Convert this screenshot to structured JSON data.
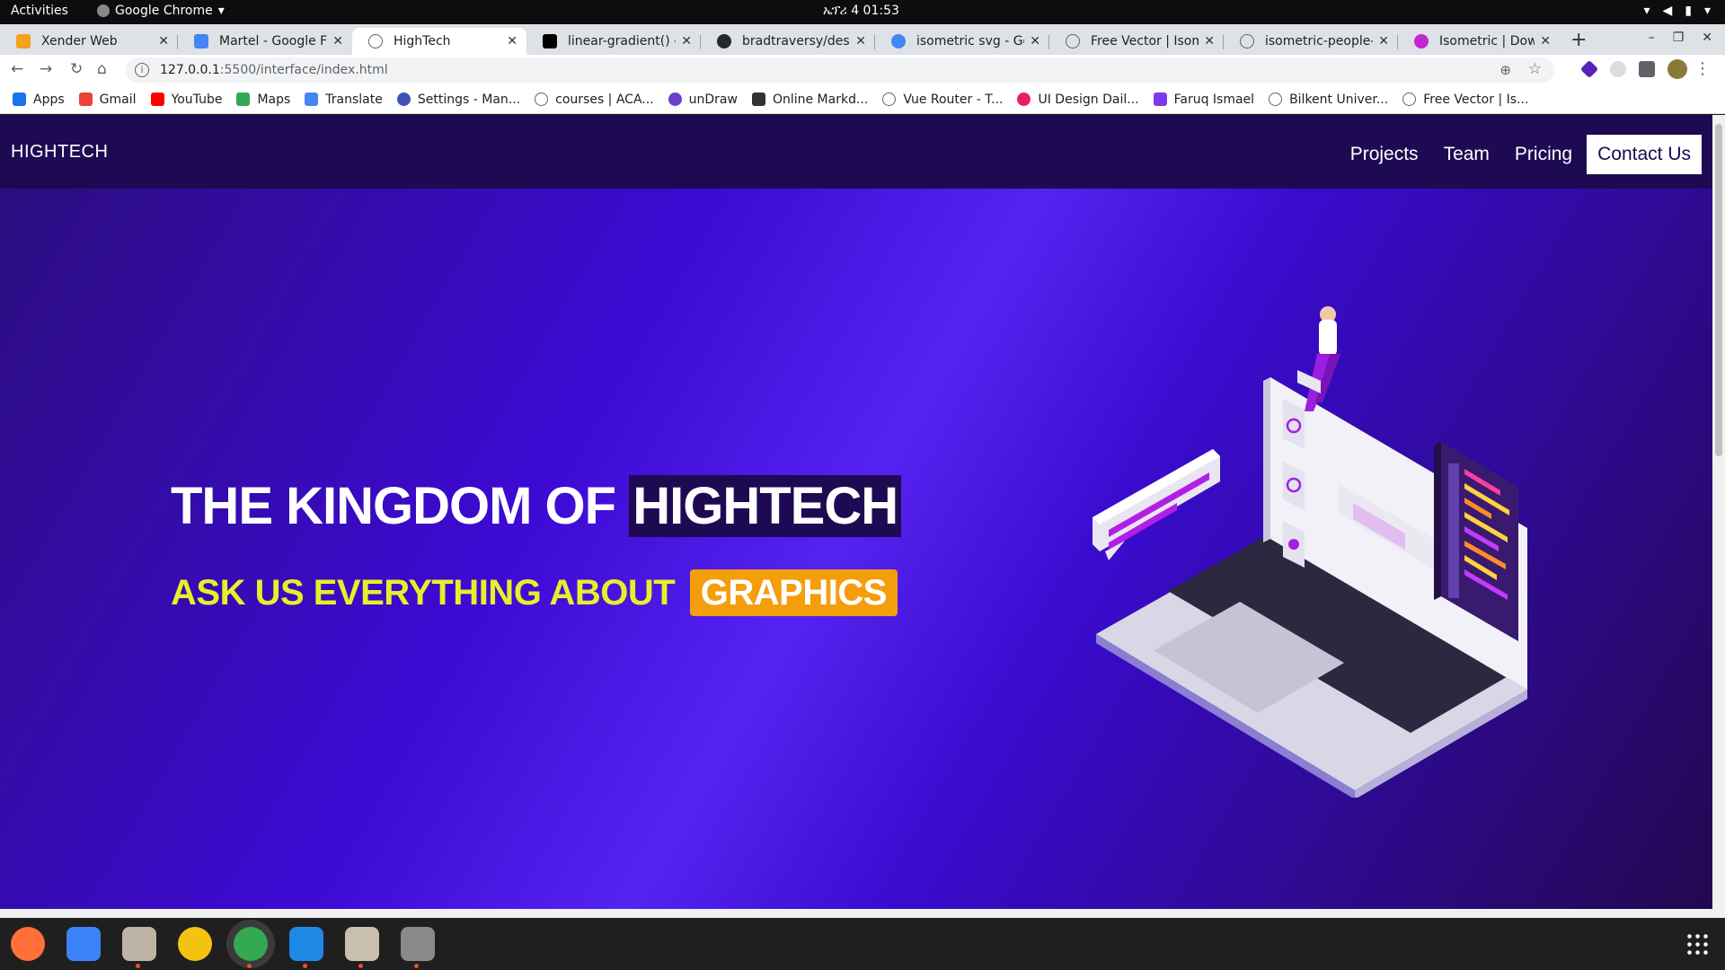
{
  "system": {
    "activities": "Activities",
    "app_name": "Google Chrome",
    "clock": "ኤፕሪ 4  01:53"
  },
  "tabs": [
    {
      "title": "Xender Web",
      "icon": "xender-icon",
      "color": "#f4a21d"
    },
    {
      "title": "Martel - Google Fo",
      "icon": "google-fonts-icon",
      "color": "#4285f4"
    },
    {
      "title": "HighTech",
      "icon": "globe-icon",
      "color": "#5f6368",
      "active": true
    },
    {
      "title": "linear-gradient() - ",
      "icon": "mdn-icon",
      "color": "#000000"
    },
    {
      "title": "bradtraversy/desig",
      "icon": "github-icon",
      "color": "#24292e"
    },
    {
      "title": "isometric svg - Goo",
      "icon": "google-icon",
      "color": "#4285f4"
    },
    {
      "title": "Free Vector | Isome",
      "icon": "globe-icon",
      "color": "#5f6368"
    },
    {
      "title": "isometric-people-v",
      "icon": "globe-icon",
      "color": "#5f6368"
    },
    {
      "title": "Isometric | Downlo",
      "icon": "undraw-icon",
      "color": "#c026d3"
    }
  ],
  "toolbar": {
    "url_host": "127.0.0.1",
    "url_rest": ":5500/interface/index.html"
  },
  "bookmarks": [
    {
      "label": "Apps",
      "icon": "apps-grid-icon",
      "color": "#1a73e8"
    },
    {
      "label": "Gmail",
      "icon": "gmail-icon",
      "color": "#ea4335"
    },
    {
      "label": "YouTube",
      "icon": "youtube-icon",
      "color": "#ff0000"
    },
    {
      "label": "Maps",
      "icon": "maps-icon",
      "color": "#34a853"
    },
    {
      "label": "Translate",
      "icon": "translate-icon",
      "color": "#4285f4"
    },
    {
      "label": "Settings - Man...",
      "icon": "settings-icon",
      "color": "#3f51b5"
    },
    {
      "label": "courses | ACA...",
      "icon": "globe-icon",
      "color": "#5f6368"
    },
    {
      "label": "unDraw",
      "icon": "undraw-icon",
      "color": "#6c3fc9"
    },
    {
      "label": "Online Markd...",
      "icon": "dillinger-icon",
      "color": "#333333"
    },
    {
      "label": "Vue Router - T...",
      "icon": "globe-icon",
      "color": "#5f6368"
    },
    {
      "label": "UI Design Dail...",
      "icon": "uidesign-icon",
      "color": "#e91e63"
    },
    {
      "label": "Faruq Ismael",
      "icon": "faruq-icon",
      "color": "#7c3aed"
    },
    {
      "label": "Bilkent Univer...",
      "icon": "globe-icon",
      "color": "#5f6368"
    },
    {
      "label": "Free Vector | Is...",
      "icon": "globe-icon",
      "color": "#5f6368"
    }
  ],
  "site": {
    "brand": "HIGHTECH",
    "nav": [
      "Projects",
      "Team",
      "Pricing"
    ],
    "contact": "Contact Us",
    "hero_line1_plain": "THE KINGDOM OF ",
    "hero_line1_highlight": "HIGHTECH",
    "hero_line2_plain": "ASK US EVERYTHING ABOUT",
    "hero_line2_highlight": "GRAPHICS"
  },
  "dock": [
    {
      "name": "firefox-icon",
      "color": "#ff7139"
    },
    {
      "name": "text-editor-icon",
      "color": "#3b82f6"
    },
    {
      "name": "files-icon",
      "color": "#bdb3a5"
    },
    {
      "name": "rhythmbox-icon",
      "color": "#f5c211"
    },
    {
      "name": "chrome-icon",
      "color": "#34a853"
    },
    {
      "name": "vscode-icon",
      "color": "#1e88e5"
    },
    {
      "name": "archive-icon",
      "color": "#c9bfae"
    },
    {
      "name": "usb-drive-icon",
      "color": "#8a8a8a"
    }
  ]
}
